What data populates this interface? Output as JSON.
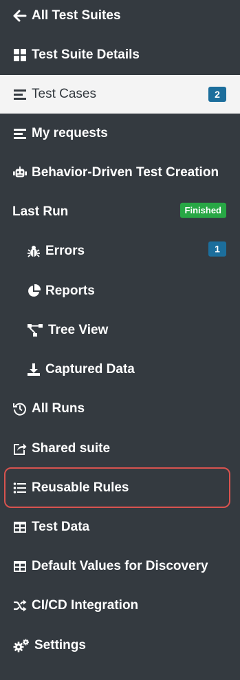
{
  "nav": {
    "back": {
      "label": "All Test Suites",
      "icon": "arrow-left-icon"
    },
    "suite_details": {
      "label": "Test Suite Details",
      "icon": "grid-icon"
    },
    "test_cases": {
      "label": "Test Cases",
      "icon": "list-icon",
      "badge": "2"
    },
    "my_requests": {
      "label": "My requests",
      "icon": "list-icon"
    },
    "bdd": {
      "label": "Behavior-Driven Test Creation",
      "icon": "robot-icon"
    },
    "last_run": {
      "label": "Last Run",
      "status": "Finished"
    },
    "errors": {
      "label": "Errors",
      "icon": "bug-icon",
      "badge": "1"
    },
    "reports": {
      "label": "Reports",
      "icon": "pie-chart-icon"
    },
    "tree_view": {
      "label": "Tree View",
      "icon": "tree-icon"
    },
    "captured_data": {
      "label": "Captured Data",
      "icon": "download-icon"
    },
    "all_runs": {
      "label": "All Runs",
      "icon": "history-icon"
    },
    "shared_suite": {
      "label": "Shared suite",
      "icon": "share-icon"
    },
    "reusable_rules": {
      "label": "Reusable Rules",
      "icon": "list-ul-icon"
    },
    "test_data": {
      "label": "Test Data",
      "icon": "table-icon"
    },
    "default_values": {
      "label": "Default Values for Discovery",
      "icon": "table-icon"
    },
    "cicd": {
      "label": "CI/CD Integration",
      "icon": "shuffle-icon"
    },
    "settings": {
      "label": "Settings",
      "icon": "gears-icon"
    }
  },
  "colors": {
    "sidebar_bg": "#343a40",
    "active_bg": "#f4f4f4",
    "badge_bg": "#1c6e9c",
    "status_bg": "#28a745",
    "highlight_border": "#d9534f"
  }
}
